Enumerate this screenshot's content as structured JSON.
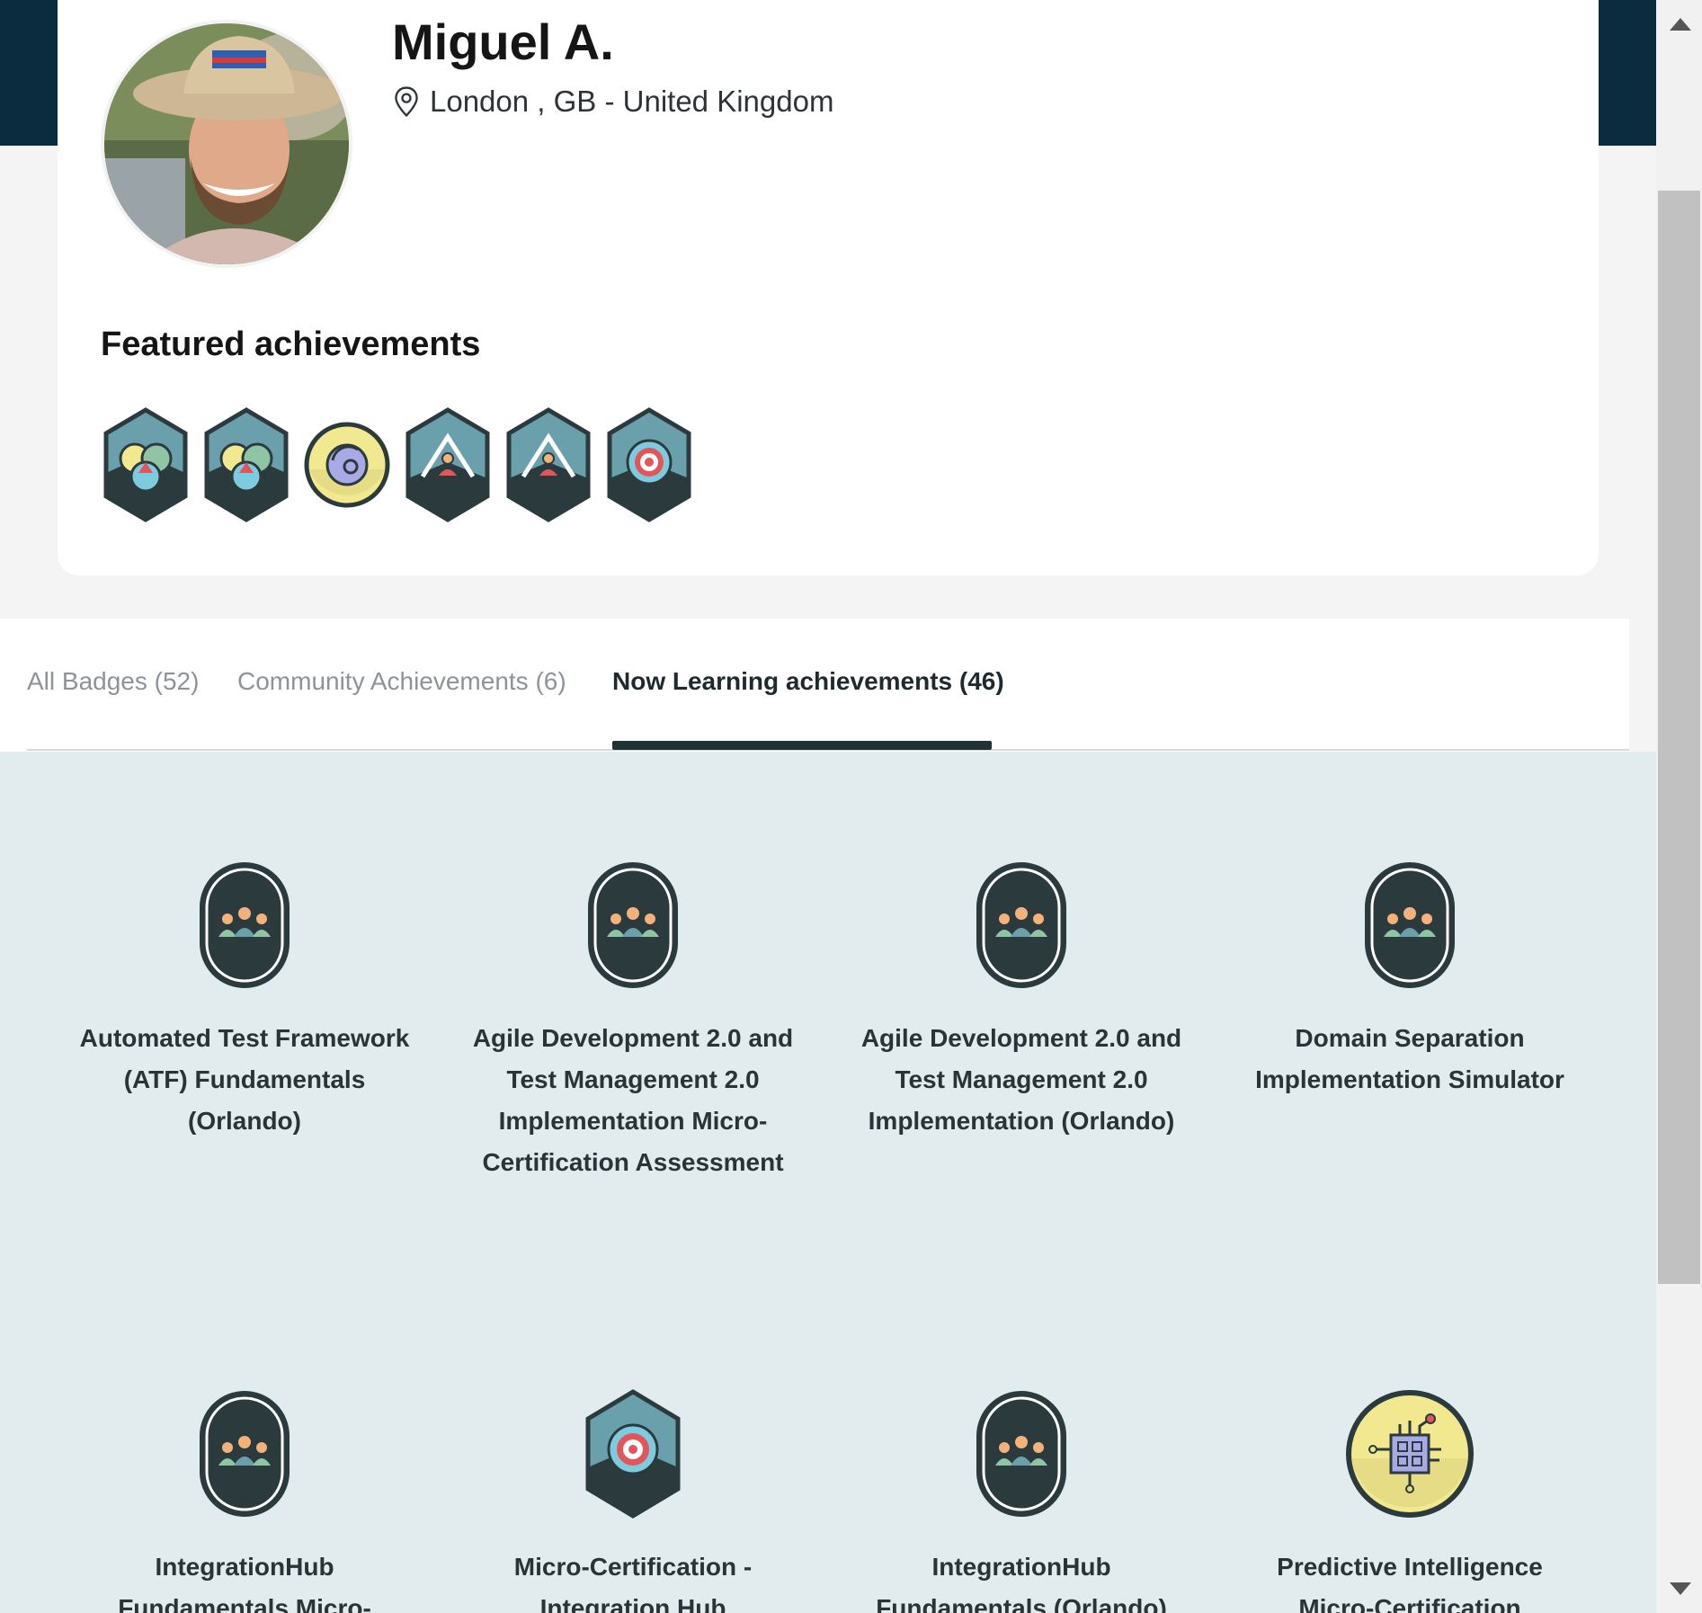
{
  "profile": {
    "name": "Miguel A.",
    "location": "London , GB - United Kingdom"
  },
  "featured": {
    "title": "Featured achievements",
    "badges": [
      {
        "icon": "venn-hex-badge-icon"
      },
      {
        "icon": "venn-hex-badge-icon"
      },
      {
        "icon": "refresh-target-round-badge-icon"
      },
      {
        "icon": "mountain-person-hex-badge-icon"
      },
      {
        "icon": "mountain-person-hex-badge-icon"
      },
      {
        "icon": "target-hex-badge-icon"
      }
    ]
  },
  "tabs": [
    {
      "label": "All Badges (52)",
      "active": false
    },
    {
      "label": "Community Achievements (6)",
      "active": false
    },
    {
      "label": "Now Learning achievements (46)",
      "active": true
    }
  ],
  "achievements": [
    {
      "title": "Automated Test Framework (ATF) Fundamentals (Orlando)",
      "icon": "group-pill-badge-icon"
    },
    {
      "title": "Agile Development 2.0 and Test Management 2.0 Implementation Micro-Certification Assessment",
      "icon": "group-pill-badge-icon"
    },
    {
      "title": "Agile Development 2.0 and Test Management 2.0 Implementation (Orlando)",
      "icon": "group-pill-badge-icon"
    },
    {
      "title": "Domain Separation Implementation Simulator",
      "icon": "group-pill-badge-icon"
    },
    {
      "title": "IntegrationHub Fundamentals Micro-",
      "icon": "group-pill-badge-icon"
    },
    {
      "title": "Micro-Certification - Integration Hub",
      "icon": "target-hex-badge-icon"
    },
    {
      "title": "IntegrationHub Fundamentals (Orlando)",
      "icon": "group-pill-badge-icon"
    },
    {
      "title": "Predictive Intelligence Micro-Certification",
      "icon": "chip-round-badge-icon"
    }
  ],
  "colors": {
    "header_band": "#0b2b3f",
    "content_bg": "#e2ebee",
    "badge_dark": "#2b3a3c",
    "badge_teal": "#6aa0ac",
    "badge_yellow": "#f2e88f"
  }
}
